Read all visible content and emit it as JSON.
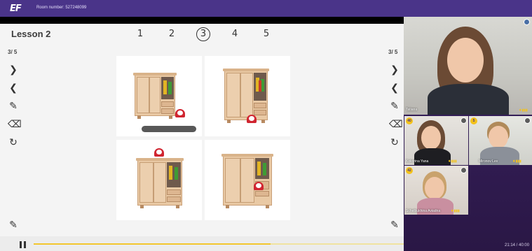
{
  "header": {
    "logo": "EF",
    "room_number": "Room number: 527248099"
  },
  "lesson": {
    "title": "Lesson 2",
    "pages": [
      "1",
      "2",
      "3",
      "4",
      "5"
    ],
    "active_page": "3",
    "counter_left": "3/ 5",
    "counter_right": "3/ 5"
  },
  "tools": {
    "next": "❯",
    "prev": "❮",
    "pen": "✎",
    "eraser": "⌫",
    "reset": "↻",
    "pencil": "✎"
  },
  "cards": [
    {
      "clock": "bottom-right-floor",
      "scribble": true
    },
    {
      "clock": "bottom-inside-base"
    },
    {
      "clock": "on-top"
    },
    {
      "clock": "in-drawer"
    }
  ],
  "video": {
    "participants": [
      {
        "name": "Tatiana",
        "badge": "",
        "role": "teacher"
      },
      {
        "name": "Kokorina Yana",
        "badge": "40"
      },
      {
        "name": "Mironov Lev",
        "badge": "5"
      },
      {
        "name": "Schelbukhina Aviadna",
        "badge": "42"
      }
    ],
    "timer": "21:14 / 40:00"
  },
  "colors": {
    "topbar": "#4a3489",
    "accent_yellow": "#f2c62e",
    "clock_red": "#d02530"
  },
  "playback": {
    "progress": 0.64
  }
}
